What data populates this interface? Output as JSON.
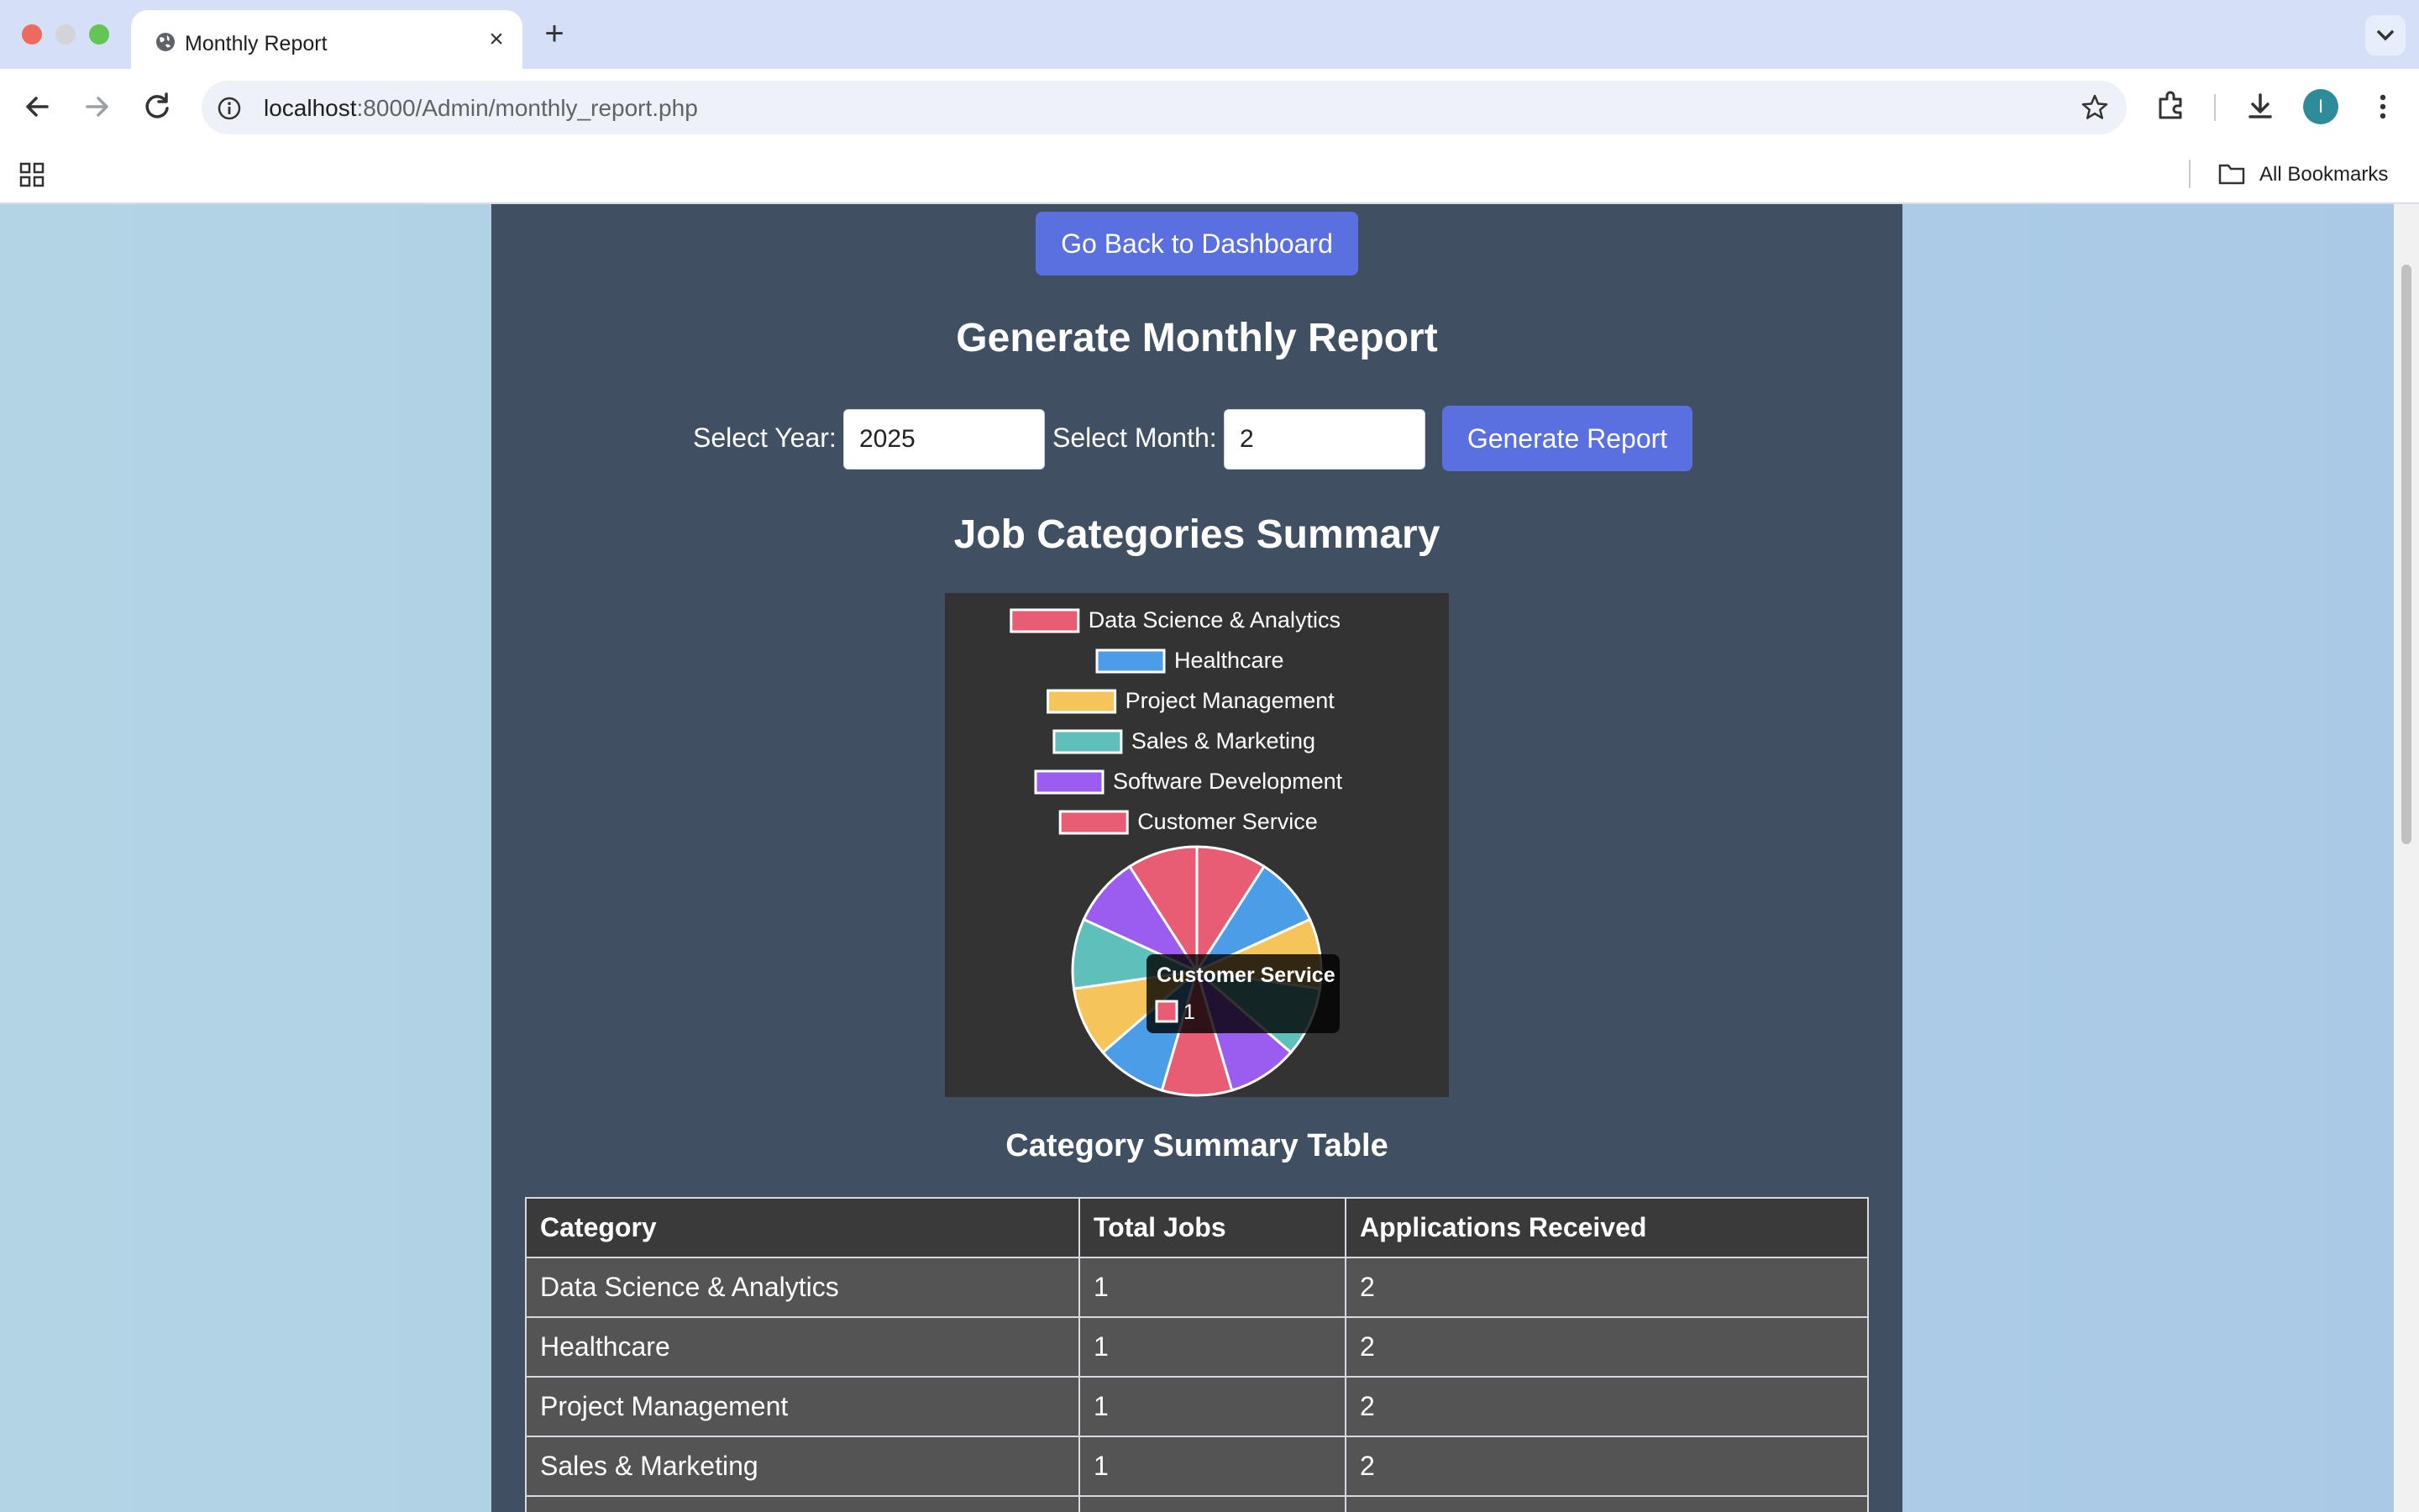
{
  "browser": {
    "tab_title": "Monthly Report",
    "url_host": "localhost",
    "url_rest": ":8000/Admin/monthly_report.php",
    "bookmarks_label": "All Bookmarks",
    "profile_initial": "I"
  },
  "page": {
    "back_button_label": "Go Back to Dashboard",
    "generate_title": "Generate Monthly Report",
    "year_label": "Select Year:",
    "year_value": "2025",
    "month_label": "Select Month:",
    "month_value": "2",
    "generate_button_label": "Generate Report",
    "categories_title": "Job Categories Summary",
    "table_title": "Category Summary Table"
  },
  "chart_data": {
    "type": "pie",
    "categories": [
      "Data Science & Analytics",
      "Healthcare",
      "Project Management",
      "Sales & Marketing",
      "Software Development",
      "Customer Service",
      "Data Science & Analytics",
      "Healthcare",
      "Project Management",
      "Sales & Marketing",
      "Software Development"
    ],
    "legend": [
      "Data Science & Analytics",
      "Healthcare",
      "Project Management",
      "Sales & Marketing",
      "Software Development",
      "Customer Service"
    ],
    "values": [
      1,
      1,
      1,
      1,
      1,
      1,
      1,
      1,
      1,
      1,
      1
    ],
    "colors": [
      "#e85d74",
      "#4a9de6",
      "#f5c45a",
      "#5fbfba",
      "#9b5cf0"
    ],
    "tooltip": {
      "title": "Customer Service",
      "value": "1"
    },
    "legend_position": "top"
  },
  "table": {
    "headers": [
      "Category",
      "Total Jobs",
      "Applications Received"
    ],
    "rows": [
      [
        "Data Science & Analytics",
        "1",
        "2"
      ],
      [
        "Healthcare",
        "1",
        "2"
      ],
      [
        "Project Management",
        "1",
        "2"
      ],
      [
        "Sales & Marketing",
        "1",
        "2"
      ],
      [
        "",
        "",
        ""
      ]
    ]
  }
}
